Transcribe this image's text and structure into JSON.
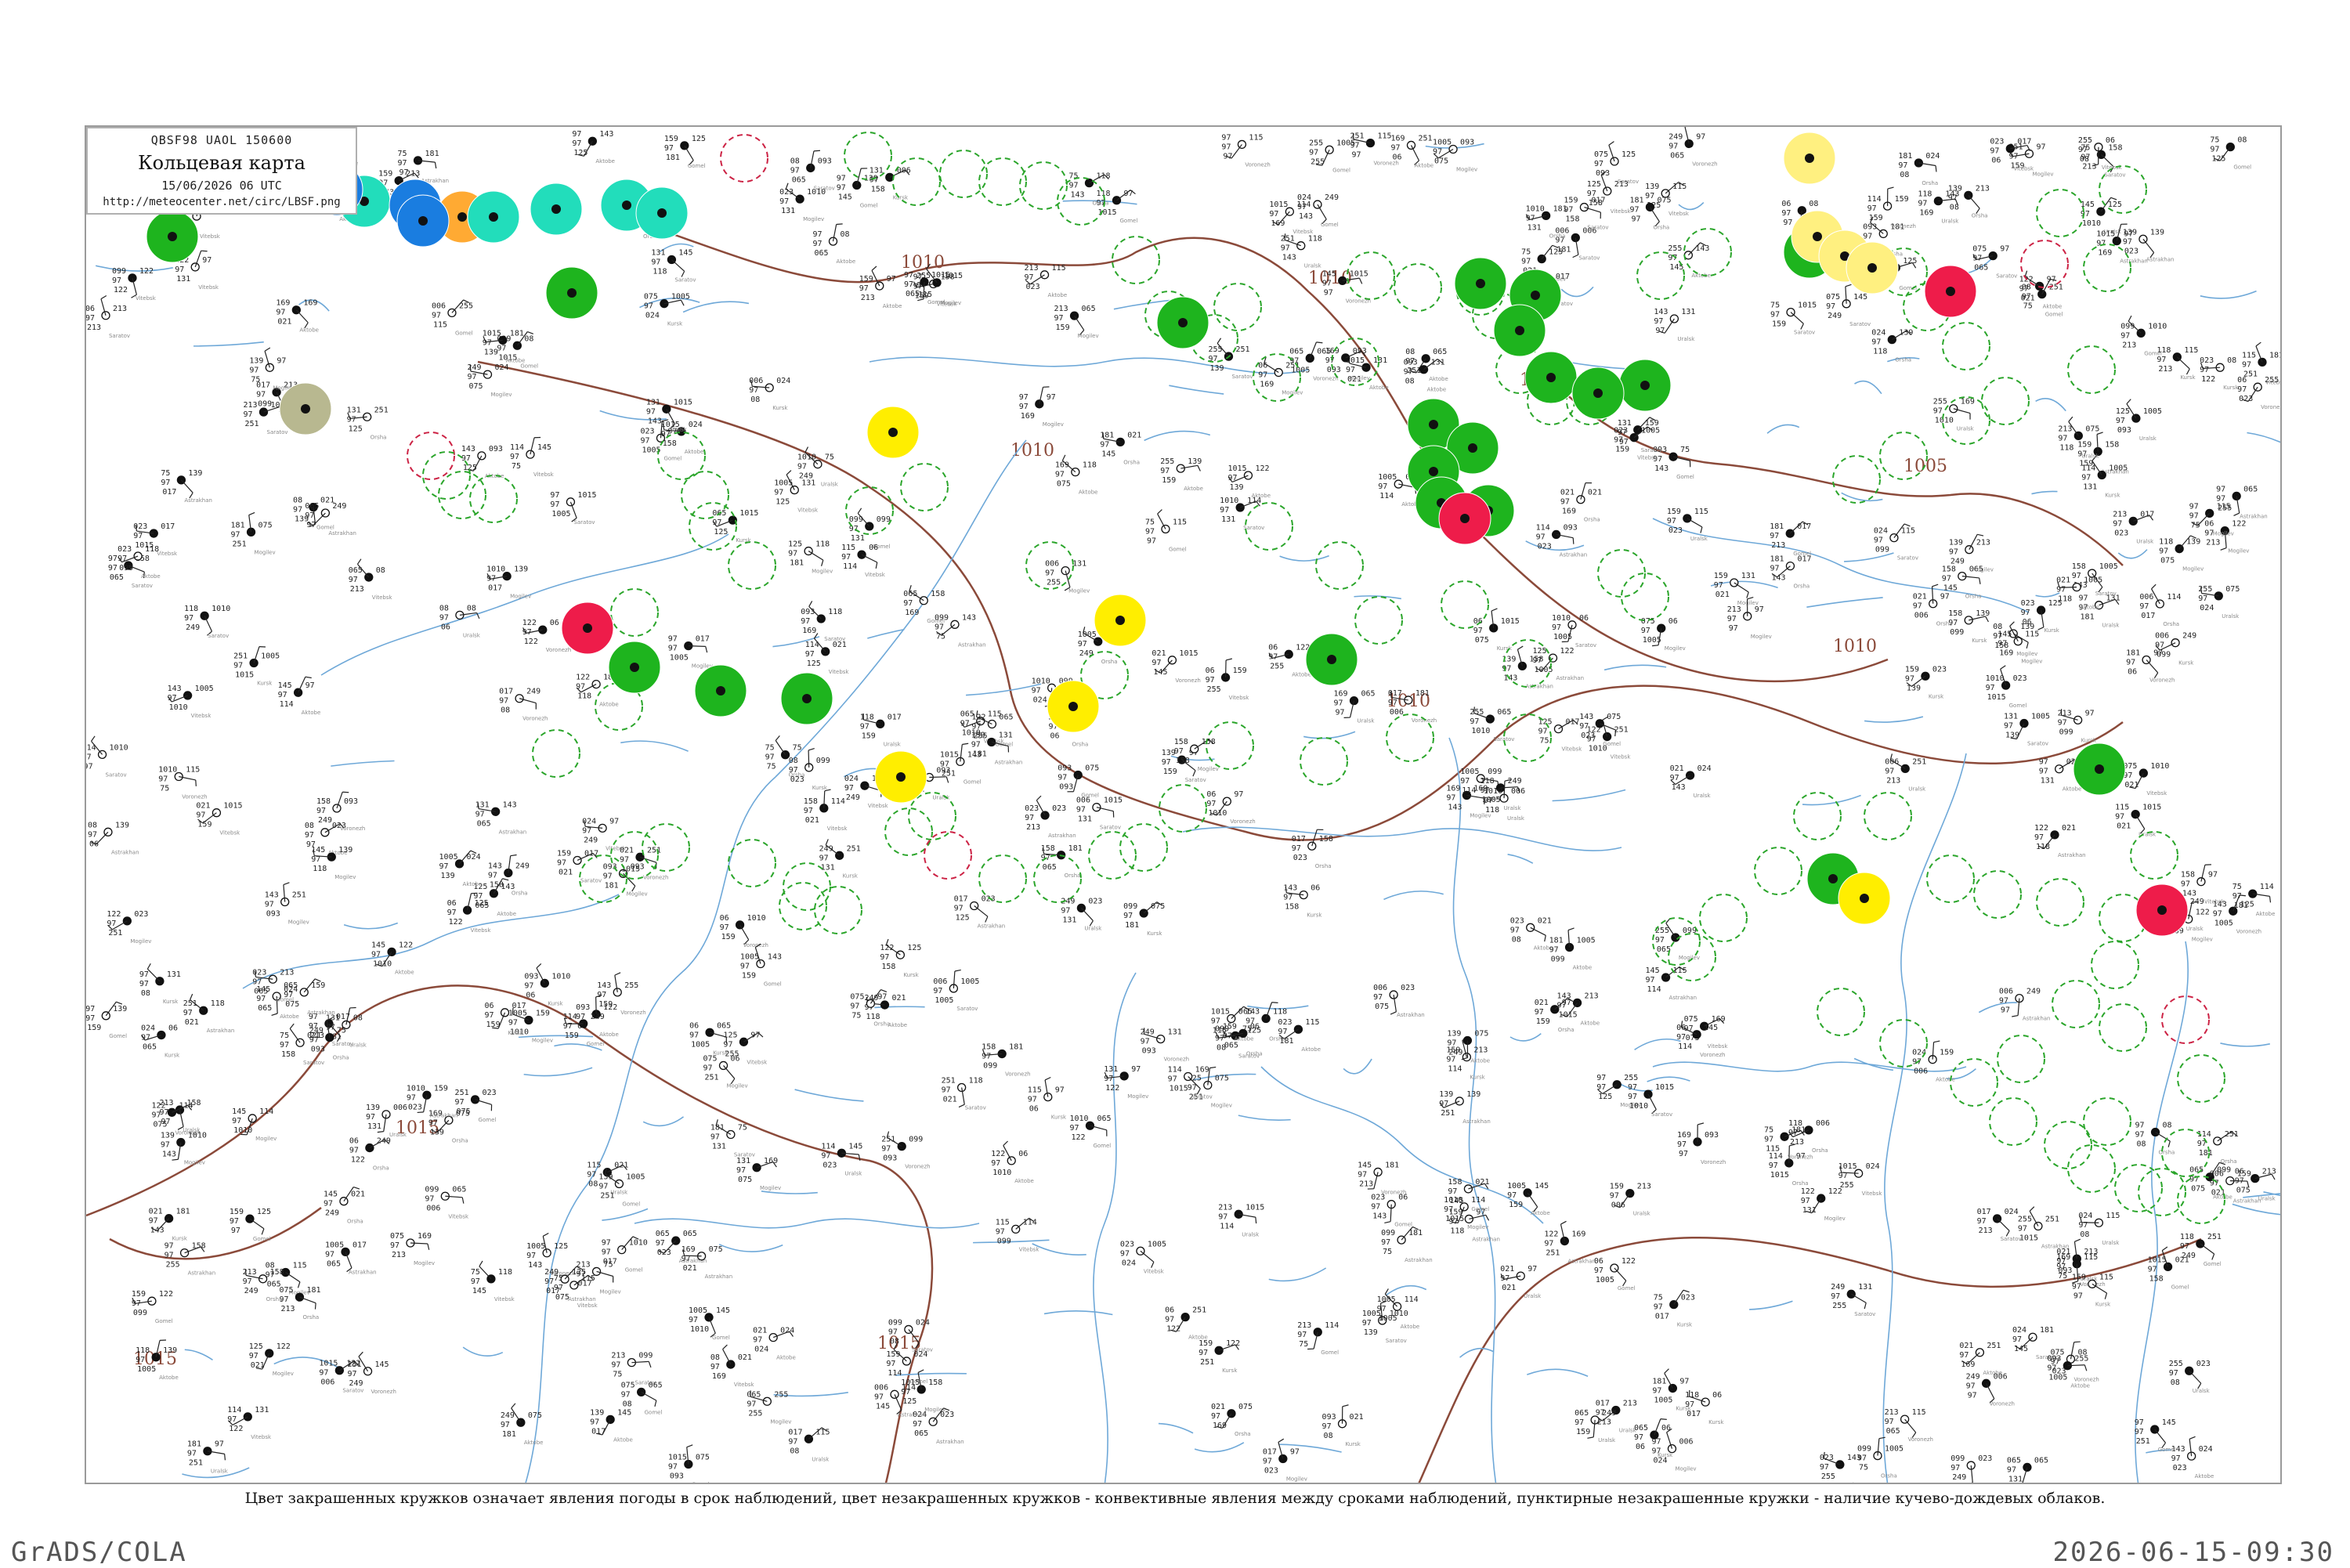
{
  "header": {
    "codes": "QBSF98  UAOL  150600",
    "title": "Кольцевая карта",
    "datetime": "15/06/2026 06 UTC",
    "url": "http://meteocenter.net/circ/LBSF.png"
  },
  "legend_note": "Цвет закрашенных кружков означает явления погоды в срок наблюдений, цвет незакрашенных кружков - конвективные явления между сроками наблюдений, пунктирные незакрашенные кружки - наличие кучево-дождевых облаков.",
  "footer": {
    "left": "GrADS/COLA",
    "right": "2026-06-15-09:30"
  },
  "colors": {
    "frame": "#9a9a9a",
    "isobar": "#8b4a3a",
    "river": "#6ea8d8",
    "dashed_ring": "#2aa52a",
    "thunder_ring": "#cc2244",
    "rain": "#1eb41e",
    "thunderstorm": "#ee1c4a",
    "haze": "#ffee00",
    "haze_light": "#fff080",
    "fog": "#ffaa33",
    "drizzle": "#22ddbb",
    "snow_shower": "#1a7de0",
    "dust": "#b8b890"
  },
  "isobars": [
    {
      "value": "1015",
      "labels": [
        "1015",
        "1015",
        "1015"
      ]
    },
    {
      "value": "1010",
      "labels": [
        "1010",
        "1010",
        "1010",
        "1010",
        "1010"
      ]
    },
    {
      "value": "1005",
      "labels": [
        "1005",
        "1005"
      ]
    }
  ],
  "filled_stations": [
    {
      "kind": "rain",
      "label": "Green"
    },
    {
      "kind": "thunderstorm",
      "label": "Red"
    },
    {
      "kind": "haze",
      "label": "Yellow"
    },
    {
      "kind": "fog",
      "label": "Orange"
    },
    {
      "kind": "drizzle",
      "label": "Cyan"
    },
    {
      "kind": "snow_shower",
      "label": "Blue"
    },
    {
      "kind": "dust",
      "label": "Olive"
    }
  ],
  "station_sample_values": [
    "122",
    "97",
    "08",
    "145",
    "139",
    "065",
    "131",
    "006",
    "118",
    "023",
    "169",
    "024",
    "181",
    "249",
    "017",
    "255",
    "251",
    "021",
    "159",
    "97",
    "06",
    "125",
    "75",
    "093",
    "099",
    "075",
    "158",
    "114",
    "143",
    "115",
    "213",
    "1010",
    "1005",
    "1015"
  ],
  "station_sample_names": [
    "Vitebsk",
    "Orsha",
    "Mogilev",
    "Gomel",
    "Kursk",
    "Voronezh",
    "Saratov",
    "Uralsk",
    "Aktobe",
    "Astrakhan"
  ]
}
